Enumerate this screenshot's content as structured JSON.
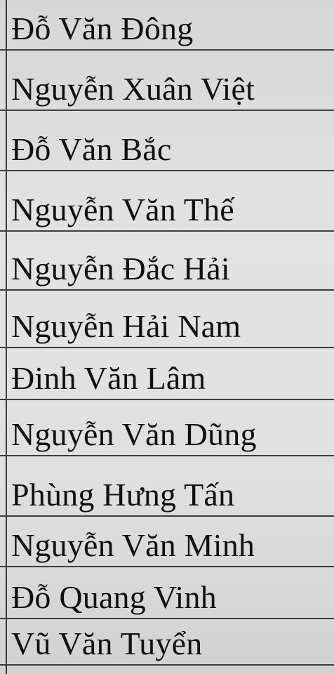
{
  "names": [
    "Đỗ Văn Đông",
    "Nguyễn Xuân Việt",
    "Đỗ Văn Bắc",
    "Nguyễn Văn Thế",
    "Nguyễn Đắc Hải",
    "Nguyễn Hải Nam",
    "Đinh Văn Lâm",
    "Nguyễn Văn Dũng",
    "Phùng Hưng Tấn",
    "Nguyễn Văn Minh",
    "Đỗ Quang Vinh",
    "Vũ Văn Tuyển"
  ]
}
